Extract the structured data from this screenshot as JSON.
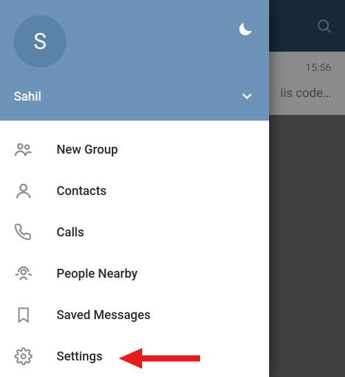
{
  "header": {
    "avatar_initial": "S",
    "username": "Sahil"
  },
  "background_chat": {
    "time": "15:56",
    "preview": "iis code…"
  },
  "menu": {
    "items": [
      {
        "icon": "group",
        "label": "New Group"
      },
      {
        "icon": "person",
        "label": "Contacts"
      },
      {
        "icon": "phone",
        "label": "Calls"
      },
      {
        "icon": "nearby",
        "label": "People Nearby"
      },
      {
        "icon": "bookmark",
        "label": "Saved Messages"
      },
      {
        "icon": "gear",
        "label": "Settings"
      }
    ]
  }
}
